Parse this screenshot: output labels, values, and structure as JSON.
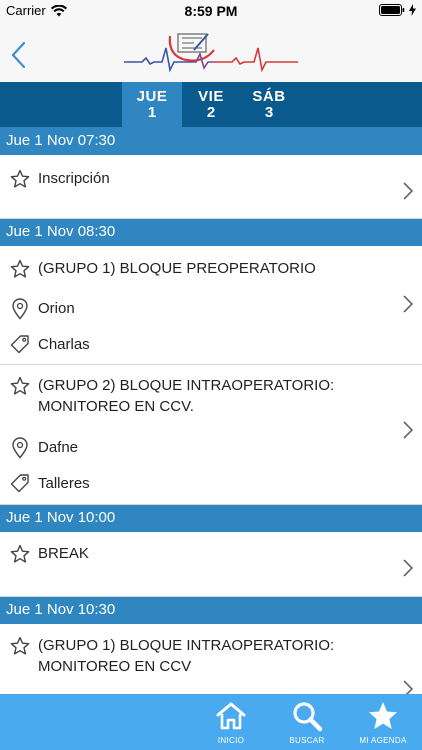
{
  "status": {
    "carrier": "Carrier",
    "time": "8:59 PM"
  },
  "days": [
    {
      "dow": "JUE",
      "num": "1"
    },
    {
      "dow": "VIE",
      "num": "2"
    },
    {
      "dow": "SÁB",
      "num": "3"
    }
  ],
  "sections": {
    "s1": "Jue 1 Nov 07:30",
    "s2": "Jue 1 Nov 08:30",
    "s3": "Jue 1 Nov 10:00",
    "s4": "Jue 1 Nov 10:30"
  },
  "events": {
    "e1": {
      "title": "Inscripción"
    },
    "e2": {
      "title": "(GRUPO 1) BLOQUE PREOPERATORIO",
      "location": "Orion",
      "tag": "Charlas"
    },
    "e3": {
      "title_line1": "(GRUPO 2) BLOQUE INTRAOPERATORIO:",
      "title_line2": "MONITOREO EN CCV.",
      "location": "Dafne",
      "tag": "Talleres"
    },
    "e4": {
      "title": "BREAK"
    },
    "e5": {
      "title_line1": "(GRUPO 1) BLOQUE INTRAOPERATORIO:",
      "title_line2": "MONITOREO EN CCV"
    }
  },
  "tabbar": {
    "home": "INICIO",
    "search": "BUSCAR",
    "agenda": "MI AGENDA"
  },
  "colors": {
    "header_dark": "#0b5a8d",
    "accent": "#2f86c0",
    "tabbar": "#4aaaf0"
  },
  "icons": [
    "wifi-icon",
    "battery-icon",
    "back-chevron-icon",
    "star-icon",
    "location-pin-icon",
    "tag-icon",
    "chevron-right-icon",
    "home-icon",
    "search-icon",
    "star-filled-icon"
  ]
}
